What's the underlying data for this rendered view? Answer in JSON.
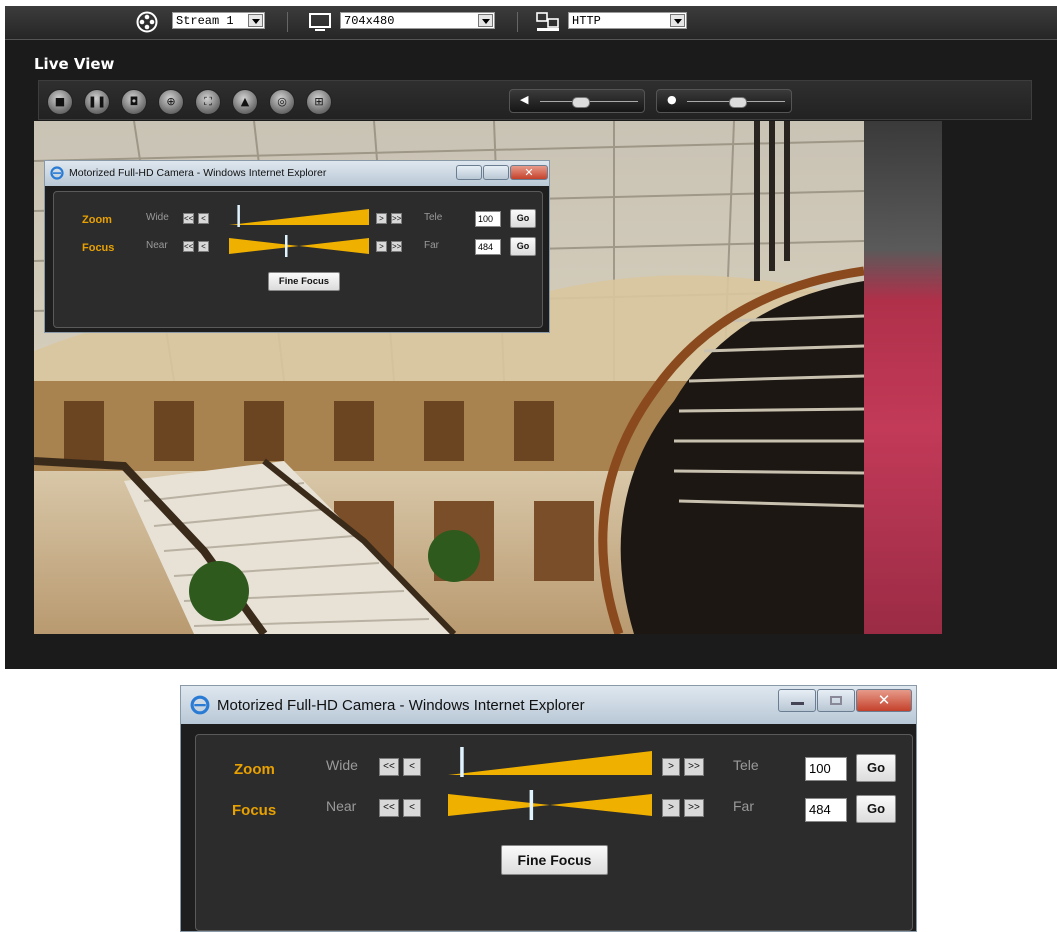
{
  "toolbar": {
    "stream_select": "Stream 1",
    "resolution_select": "704x480",
    "protocol_select": "HTTP"
  },
  "live_view": {
    "title": "Live View",
    "buttons": [
      "stop-icon",
      "pause-icon",
      "snapshot-icon",
      "zoom-icon",
      "fullscreen-icon",
      "record-icon",
      "settings-icon",
      "grid-icon"
    ]
  },
  "popup": {
    "window_title": "Motorized Full-HD Camera - Windows Internet Explorer",
    "zoom_label": "Zoom",
    "focus_label": "Focus",
    "wide_label": "Wide",
    "tele_label": "Tele",
    "near_label": "Near",
    "far_label": "Far",
    "btn_fast_back": "<<",
    "btn_back": "<",
    "btn_fwd": ">",
    "btn_fast_fwd": ">>",
    "zoom_value": "100",
    "focus_value": "484",
    "go_label": "Go",
    "fine_focus_label": "Fine Focus",
    "zoom_position": 0.06,
    "focus_position": 0.4
  },
  "colors": {
    "accent": "#e9a100",
    "panel_bg": "#1b1b1b"
  }
}
